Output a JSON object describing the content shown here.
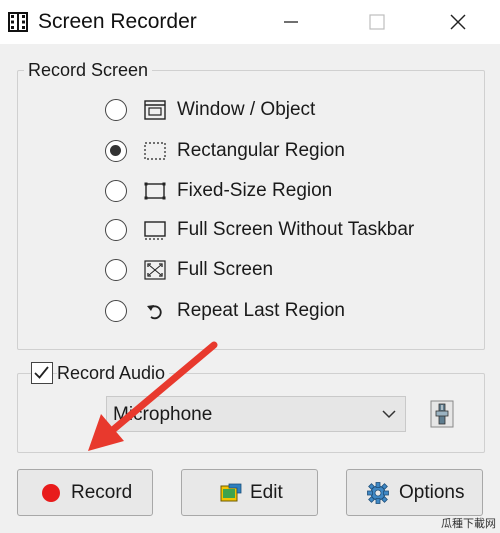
{
  "window": {
    "title": "Screen Recorder",
    "controls": [
      "minimize-icon",
      "maximize-icon",
      "close-icon"
    ]
  },
  "record_screen": {
    "group_label": "Record Screen",
    "options": [
      {
        "label": "Window / Object",
        "icon": "window-object-icon",
        "selected": false
      },
      {
        "label": "Rectangular Region",
        "icon": "rectangular-region-icon",
        "selected": true
      },
      {
        "label": "Fixed-Size Region",
        "icon": "fixed-size-region-icon",
        "selected": false
      },
      {
        "label": "Full Screen Without Taskbar",
        "icon": "fullscreen-no-taskbar-icon",
        "selected": false
      },
      {
        "label": "Full Screen",
        "icon": "fullscreen-icon",
        "selected": false
      },
      {
        "label": "Repeat Last Region",
        "icon": "repeat-region-icon",
        "selected": false
      }
    ]
  },
  "record_audio": {
    "label": "Record Audio",
    "checked": true,
    "device": "Microphone"
  },
  "buttons": {
    "record": "Record",
    "edit": "Edit",
    "options": "Options"
  },
  "colors": {
    "arrow": "#e8392d",
    "record_dot": "#e81b1b"
  },
  "watermark": "瓜種下載网"
}
